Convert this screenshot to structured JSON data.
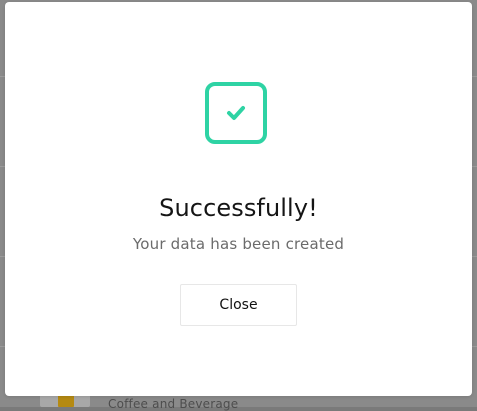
{
  "modal": {
    "title": "Successfully!",
    "message": "Your data has been created",
    "close_label": "Close",
    "icon": "check-square-icon",
    "accent_color": "#2ed3a4"
  },
  "background": {
    "row_text": "Coffee and Beverage"
  }
}
